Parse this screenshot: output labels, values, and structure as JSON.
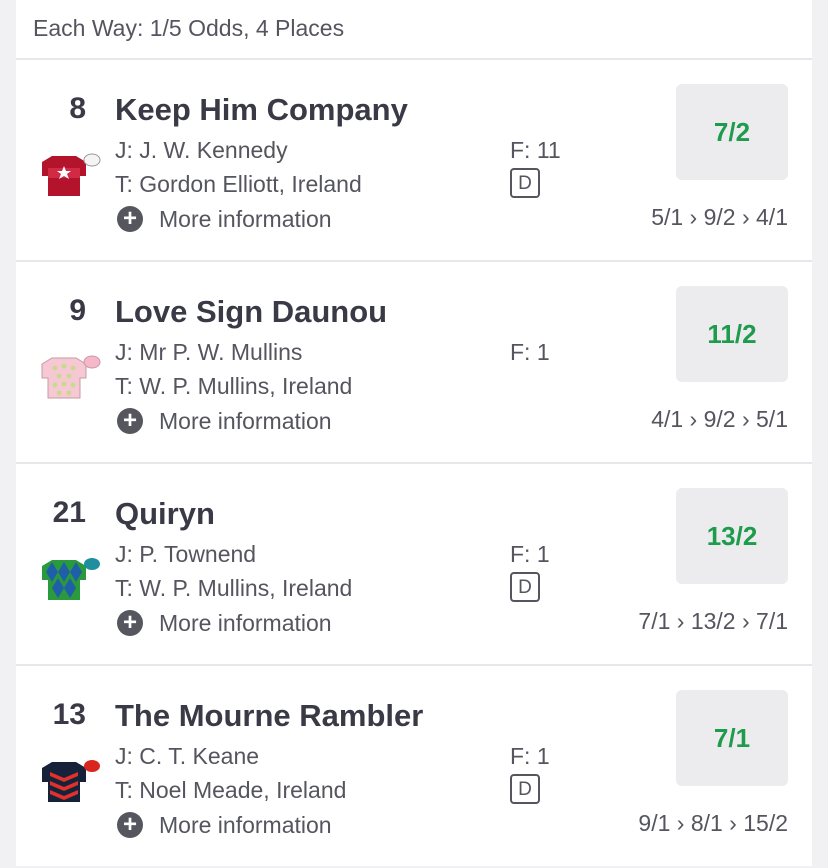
{
  "header": {
    "each_way": "Each Way: 1/5 Odds, 4 Places"
  },
  "runners": [
    {
      "number": "8",
      "name": "Keep Him Company",
      "jockey": "J: J. W. Kennedy",
      "trainer": "T: Gordon Elliott, Ireland",
      "form": "F: 11",
      "badge": "D",
      "more": "More information",
      "odds": "7/2",
      "history": "5/1 › 9/2 › 4/1",
      "silks_icon": "red-silks-white-star-icon"
    },
    {
      "number": "9",
      "name": "Love Sign Daunou",
      "jockey": "J: Mr P. W. Mullins",
      "trainer": "T: W. P. Mullins, Ireland",
      "form": "F: 1",
      "badge": "",
      "more": "More information",
      "odds": "11/2",
      "history": "4/1 › 9/2 › 5/1",
      "silks_icon": "pink-silks-green-spots-icon"
    },
    {
      "number": "21",
      "name": "Quiryn",
      "jockey": "J: P. Townend",
      "trainer": "T: W. P. Mullins, Ireland",
      "form": "F: 1",
      "badge": "D",
      "more": "More information",
      "odds": "13/2",
      "history": "7/1 › 13/2 › 7/1",
      "silks_icon": "green-blue-diamond-silks-icon"
    },
    {
      "number": "13",
      "name": "The Mourne Rambler",
      "jockey": "J: C. T. Keane",
      "trainer": "T: Noel Meade, Ireland",
      "form": "F: 1",
      "badge": "D",
      "more": "More information",
      "odds": "7/1",
      "history": "9/1 › 8/1 › 15/2",
      "silks_icon": "navy-red-chevron-silks-icon"
    }
  ],
  "colors": {
    "odds_text": "#1e9b4d",
    "odds_bg": "#ececef",
    "text_dark": "#3a3a46",
    "text_muted": "#55555f"
  }
}
